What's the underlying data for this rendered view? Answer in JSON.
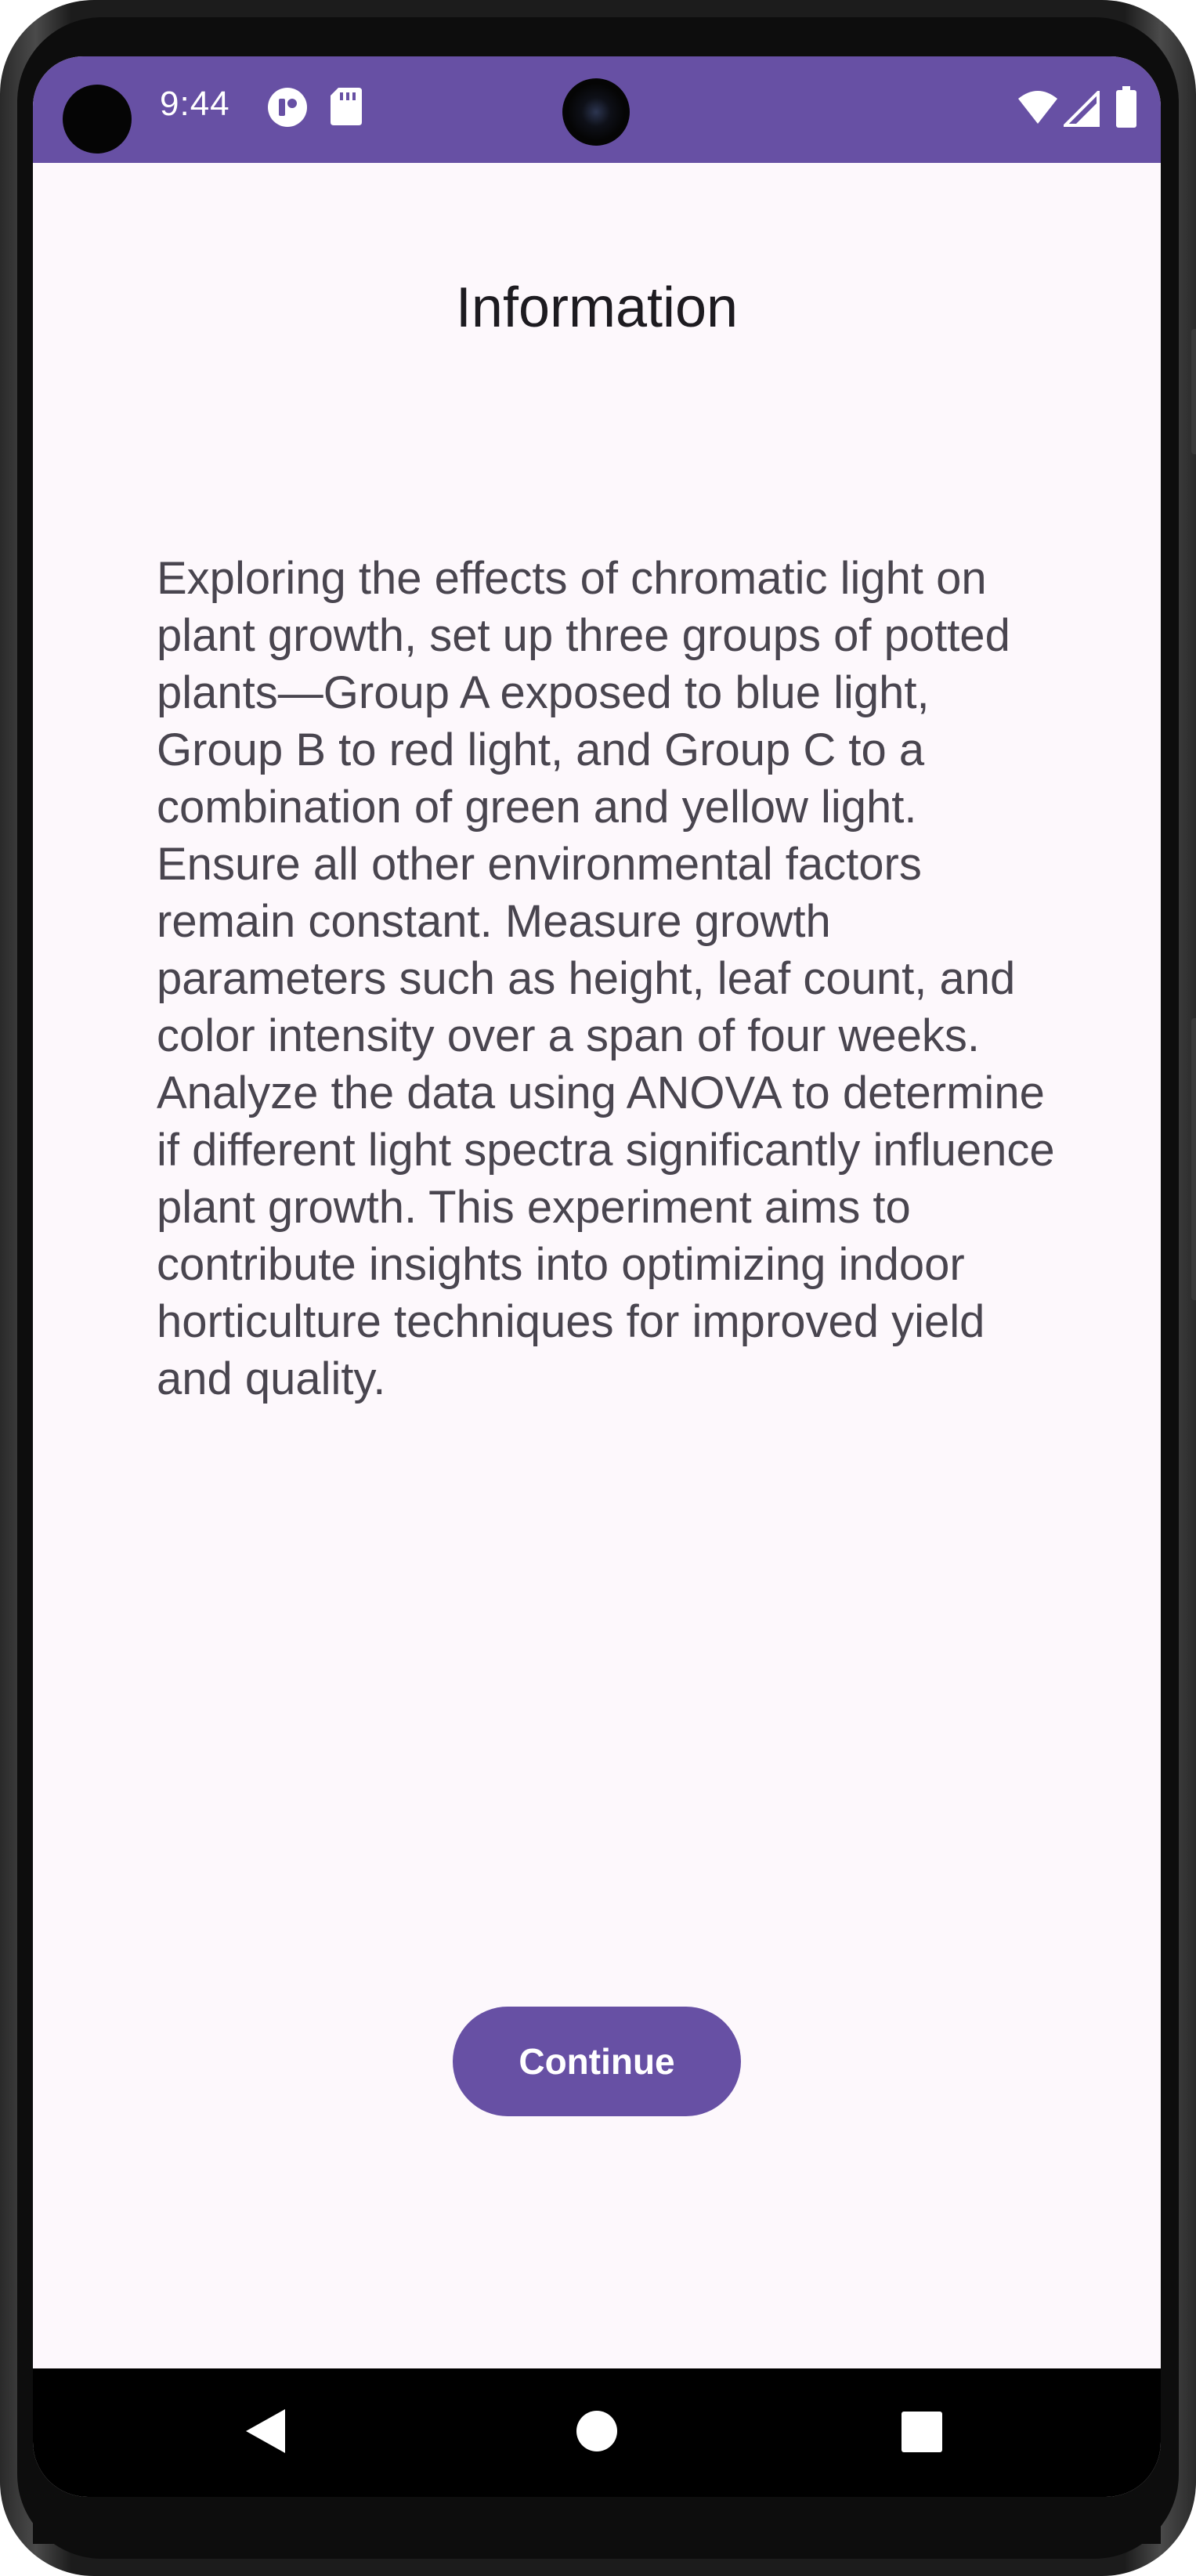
{
  "status_bar": {
    "time": "9:44",
    "background_color": "#6750a4",
    "left_icons": [
      "assistant-icon",
      "sd-card-icon"
    ],
    "right_icons": [
      "wifi-icon",
      "cellular-signal-icon",
      "battery-icon"
    ]
  },
  "screen": {
    "title": "Information",
    "body": "Exploring the effects of chromatic light on plant growth, set up three groups of potted plants—Group A exposed to blue light, Group B to red light, and Group C to a combination of green and yellow light. Ensure all other environmental factors remain constant. Measure growth parameters such as height, leaf count, and color intensity over a span of four weeks. Analyze the data using ANOVA to determine if different light spectra significantly influence plant growth. This experiment aims to contribute insights into optimizing indoor horticulture techniques for improved yield and quality.",
    "continue_label": "Continue",
    "accent_color": "#6750a4",
    "background_color": "#fdf8fc"
  },
  "nav_bar": {
    "icons": [
      "back-icon",
      "home-icon",
      "recents-icon"
    ]
  }
}
